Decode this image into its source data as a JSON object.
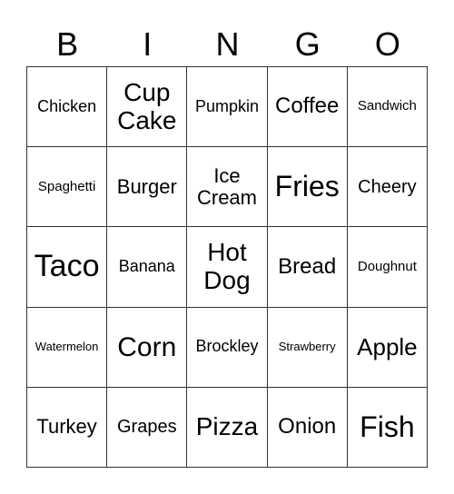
{
  "header": [
    "B",
    "I",
    "N",
    "G",
    "O"
  ],
  "cells": [
    "Chicken",
    "Cup Cake",
    "Pumpkin",
    "Coffee",
    "Sandwich",
    "Spaghetti",
    "Burger",
    "Ice Cream",
    "Fries",
    "Cheery",
    "Taco",
    "Banana",
    "Hot Dog",
    "Bread",
    "Doughnut",
    "Watermelon",
    "Corn",
    "Brockley",
    "Strawberry",
    "Apple",
    "Turkey",
    "Grapes",
    "Pizza",
    "Onion",
    "Fish"
  ]
}
